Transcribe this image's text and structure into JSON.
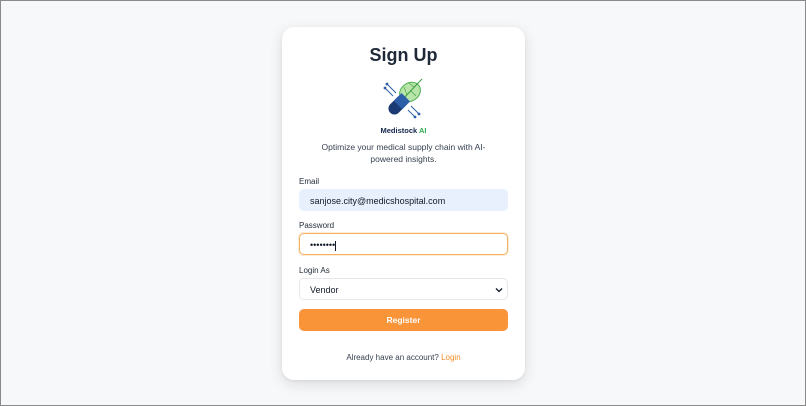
{
  "page": {
    "title": "Sign Up",
    "brand_name": "Medistock",
    "brand_suffix": "AI",
    "tagline": "Optimize your medical supply chain with AI-powered insights."
  },
  "form": {
    "email": {
      "label": "Email",
      "value": "sanjose.city@medicshospital.com"
    },
    "password": {
      "label": "Password",
      "masked_value": "••••••••"
    },
    "login_as": {
      "label": "Login As",
      "selected": "Vendor"
    },
    "register_label": "Register"
  },
  "footer": {
    "prompt": "Already have an account?",
    "link_label": "Login"
  },
  "colors": {
    "accent": "#f99438",
    "link": "#f08a24",
    "brand_ai": "#2ea94b",
    "brand_dark": "#14264a",
    "email_bg": "#e8f0fe",
    "focus_border": "#f3b161"
  },
  "icons": {
    "logo": "medistock-logo-icon",
    "select_arrow": "chevron-down-icon"
  }
}
